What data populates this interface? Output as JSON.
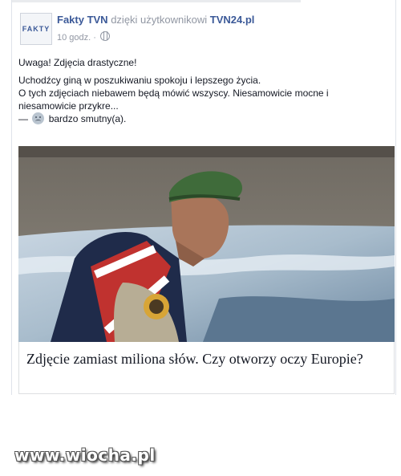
{
  "post": {
    "author": "Fakty TVN",
    "via_text": "dzięki użytkownikowi",
    "via_user": "TVN24.pl",
    "avatar_text": "FAKTY",
    "timestamp": "10 godz.",
    "separator": "·",
    "lines": {
      "warning": "Uwaga! Zdjęcia drastyczne!",
      "line1": "Uchodźcy giną w poszukiwaniu spokoju i lepszego życia.",
      "line2": "O tych zdjęciach niebawem będą mówić wszyscy. Niesamowicie mocne i niesamowicie przykre...",
      "feeling_prefix": "—",
      "feeling": "bardzo smutny(a)."
    },
    "link": {
      "title": "Zdjęcie zamiast miliona słów. Czy otworzy oczy Europie?"
    },
    "icons": {
      "privacy": "globe-icon",
      "feeling": "sad-face-icon"
    }
  },
  "watermark": "www.wiocha.pl"
}
